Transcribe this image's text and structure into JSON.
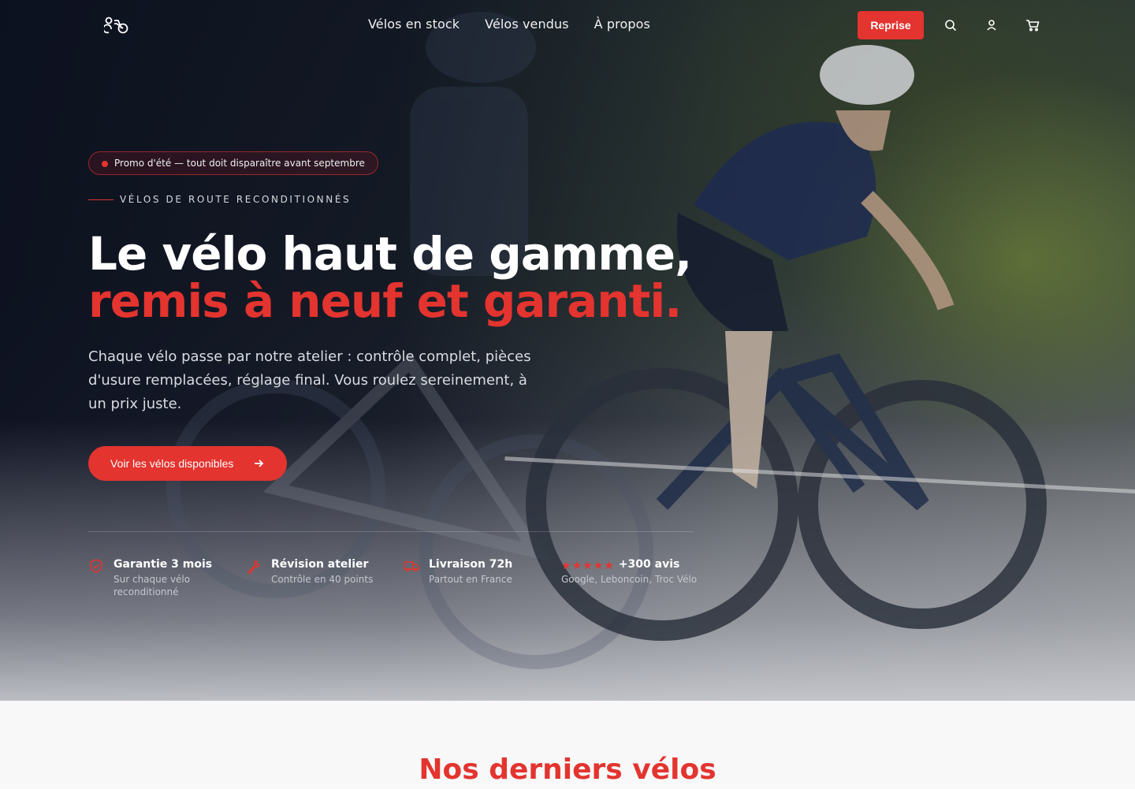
{
  "nav": {
    "logo_icon": "bicycle-logo-icon",
    "links": [
      "Vélos en stock",
      "Vélos vendus",
      "À propos"
    ],
    "reprise_label": "Reprise",
    "icons": [
      "search-icon",
      "user-icon",
      "cart-icon"
    ]
  },
  "hero": {
    "promo": "Promo d'été — tout doit disparaître avant septembre",
    "eyebrow": "VÉLOS DE ROUTE RECONDITIONNÉS",
    "title_line1": "Le vélo haut de gamme,",
    "title_line2": "remis à neuf et garanti.",
    "lead": "Chaque vélo passe par notre atelier : contrôle complet, pièces d'usure remplacées, réglage final. Vous roulez sereinement, à un prix juste.",
    "cta_label": "Voir les vélos disponibles",
    "features": [
      {
        "icon": "shield-check-icon",
        "title": "Garantie 3 mois",
        "subtitle": "Sur chaque vélo reconditionné"
      },
      {
        "icon": "wrench-icon",
        "title": "Révision atelier",
        "subtitle": "Contrôle en 40 points"
      },
      {
        "icon": "truck-icon",
        "title": "Livraison 72h",
        "subtitle": "Partout en France"
      },
      {
        "icon": "star-icon",
        "title": "+300 avis",
        "subtitle": "Google, Leboncoin, Troc Vélo",
        "stars": 5
      }
    ]
  },
  "section": {
    "title": "Nos derniers vélos"
  },
  "colors": {
    "accent": "#e3342f",
    "dark": "#0c1020"
  }
}
